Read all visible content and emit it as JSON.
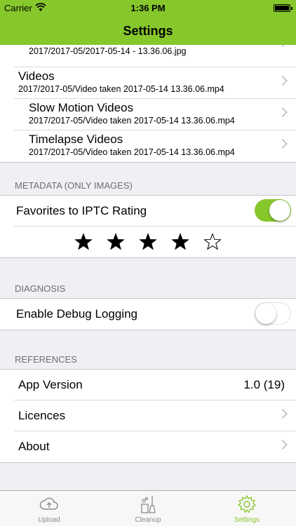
{
  "status_bar": {
    "carrier": "Carrier",
    "time": "1:36 PM"
  },
  "nav": {
    "title": "Settings"
  },
  "paths": {
    "top_partial_sub": "2017/2017-05/2017-05-14 - 13.36.06.jpg",
    "videos": {
      "label": "Videos",
      "sub": "2017/2017-05/Video taken 2017-05-14 13.36.06.mp4"
    },
    "slow_motion": {
      "label": "Slow Motion Videos",
      "sub": "2017/2017-05/Video taken 2017-05-14 13.36.06.mp4"
    },
    "timelapse": {
      "label": "Timelapse Videos",
      "sub": "2017/2017-05/Video taken 2017-05-14 13.36.06.mp4"
    }
  },
  "metadata": {
    "header": "METADATA (ONLY IMAGES)",
    "favorites_label": "Favorites to IPTC Rating",
    "favorites_on": true,
    "rating": 4,
    "max_rating": 5
  },
  "diagnosis": {
    "header": "DIAGNOSIS",
    "debug_label": "Enable Debug Logging",
    "debug_on": false
  },
  "references": {
    "header": "REFERENCES",
    "app_version_label": "App Version",
    "app_version_value": "1.0 (19)",
    "licences_label": "Licences",
    "about_label": "About"
  },
  "tabs": [
    {
      "label": "Upload",
      "icon": "cloud-upload-icon",
      "active": false
    },
    {
      "label": "Cleanup",
      "icon": "cleanup-icon",
      "active": false
    },
    {
      "label": "Settings",
      "icon": "gear-icon",
      "active": true
    }
  ],
  "colors": {
    "accent": "#86c72b",
    "background": "#efeff4",
    "header_text": "#6d6d72"
  }
}
